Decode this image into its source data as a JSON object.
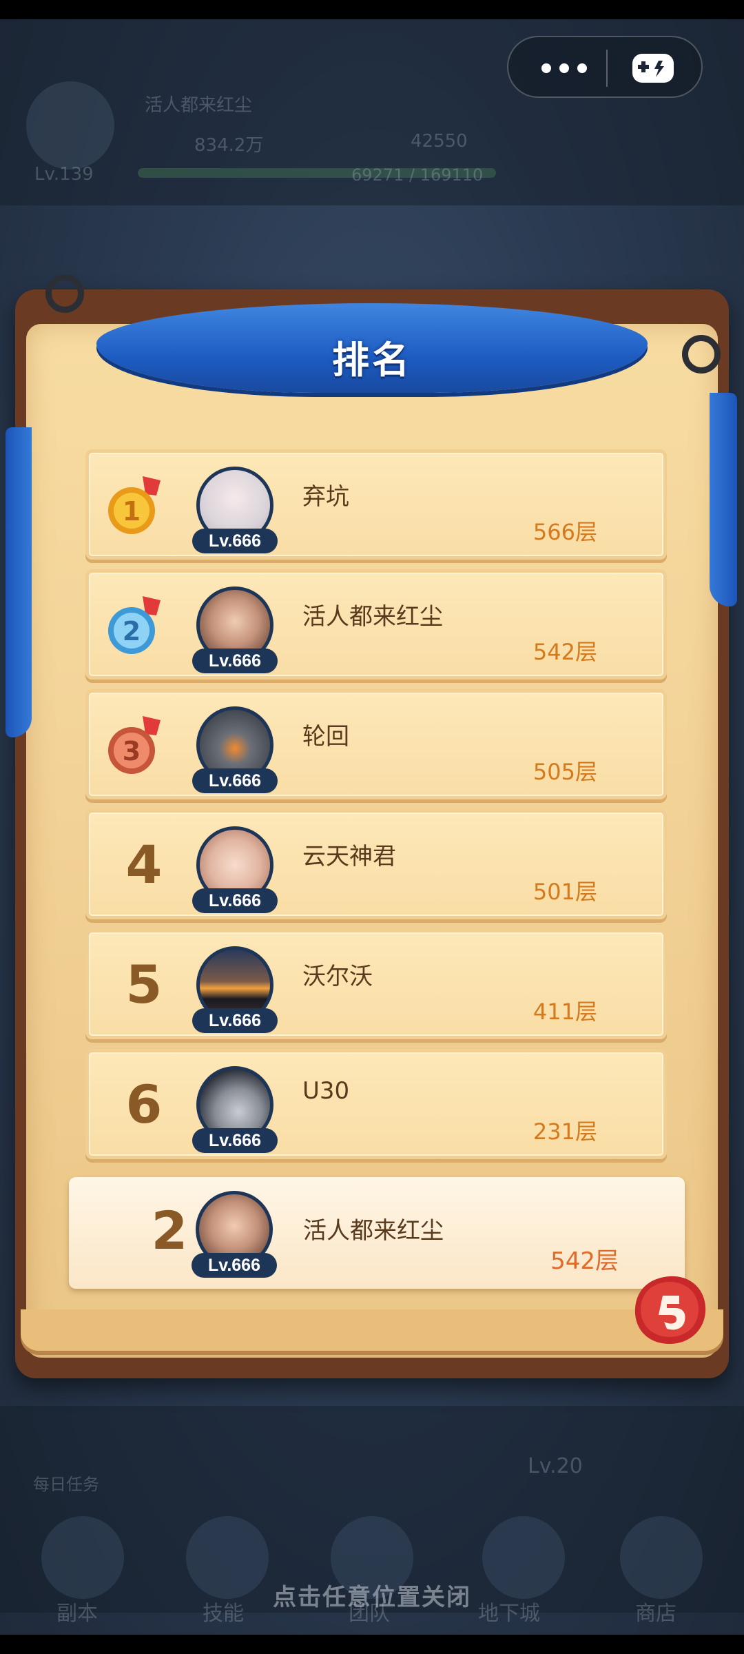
{
  "background": {
    "player_name": "活人都来红尘",
    "level": "Lv.139",
    "gold": "834.2万",
    "gems": "42550",
    "exp": "69271 / 169110",
    "daily_label": "每日任务",
    "nav": [
      "副本",
      "技能",
      "团队",
      "地下城",
      "商店"
    ],
    "right_level": "Lv.20"
  },
  "capsule": {
    "more_icon": "more-dots-icon",
    "game_icon": "gamepad-icon"
  },
  "panel": {
    "title": "排名",
    "colors": {
      "banner": "#1e5cc2",
      "parchment": "#f7dca2",
      "floors": "#d47a1c"
    }
  },
  "rankings": [
    {
      "rank": "1",
      "medal": "gold-medal-icon",
      "level": "Lv.666",
      "name": "弃坑",
      "floors": "566层"
    },
    {
      "rank": "2",
      "medal": "silver-medal-icon",
      "level": "Lv.666",
      "name": "活人都来红尘",
      "floors": "542层"
    },
    {
      "rank": "3",
      "medal": "bronze-medal-icon",
      "level": "Lv.666",
      "name": "轮回",
      "floors": "505层"
    },
    {
      "rank": "4",
      "level": "Lv.666",
      "name": "云天神君",
      "floors": "501层"
    },
    {
      "rank": "5",
      "level": "Lv.666",
      "name": "沃尔沃",
      "floors": "411层"
    },
    {
      "rank": "6",
      "level": "Lv.666",
      "name": "U30",
      "floors": "231层"
    }
  ],
  "my_rank": {
    "rank": "2",
    "level": "Lv.666",
    "name": "活人都来红尘",
    "floors": "542层"
  },
  "back_button_icon": "return-arrow-icon",
  "close_hint": "点击任意位置关闭"
}
